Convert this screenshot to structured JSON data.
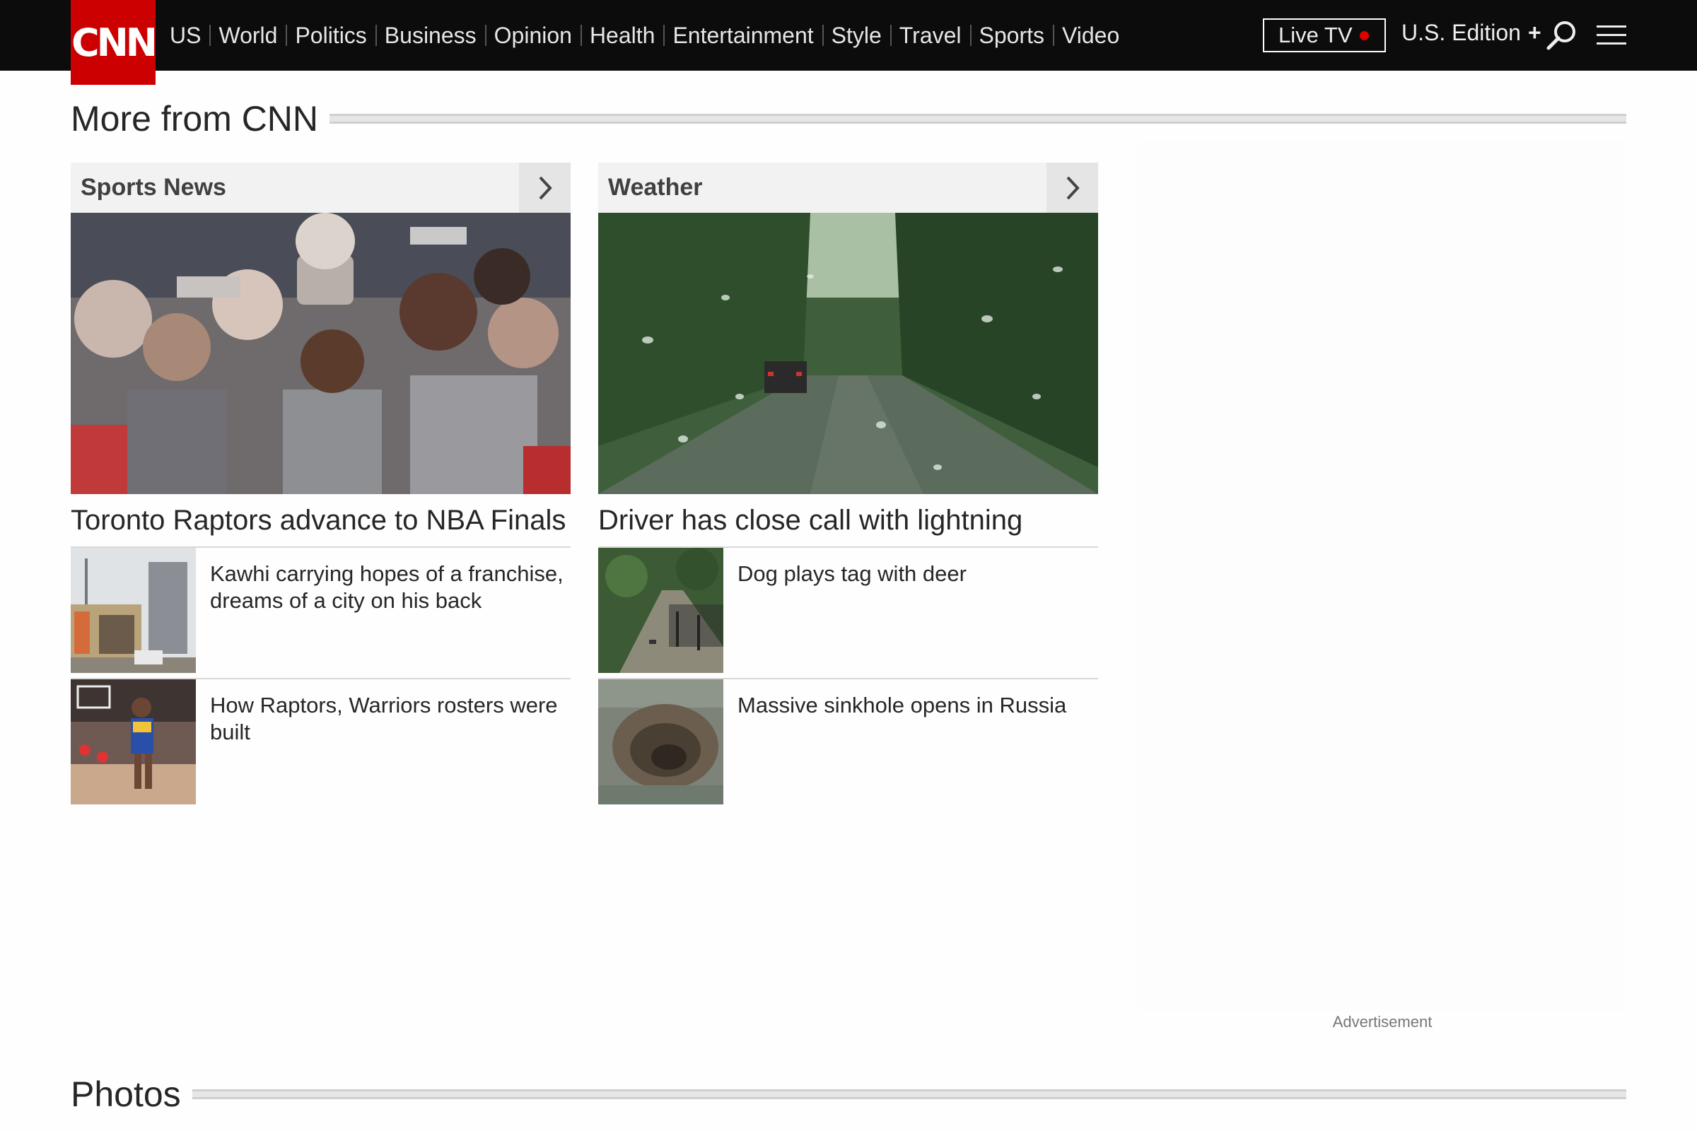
{
  "header": {
    "logo_text": "CNN",
    "brand_color": "#cc0000",
    "nav": [
      "US",
      "World",
      "Politics",
      "Business",
      "Opinion",
      "Health",
      "Entertainment",
      "Style",
      "Travel",
      "Sports",
      "Video"
    ],
    "live_tv_label": "Live TV",
    "edition_label": "U.S. Edition",
    "edition_plus": "+",
    "icons": [
      "search-icon",
      "menu-icon"
    ]
  },
  "more_from": {
    "title": "More from CNN",
    "columns": [
      {
        "label": "Sports News",
        "hero_image": "raptors-celebration-photo",
        "hero_title": "Toronto Raptors advance to NBA Finals",
        "items": [
          {
            "image": "toronto-street-photo",
            "title": "Kawhi carrying hopes of a franchise, dreams of a city on his back"
          },
          {
            "image": "warriors-player-photo",
            "title": "How Raptors, Warriors rosters were built"
          }
        ]
      },
      {
        "label": "Weather",
        "hero_image": "rainy-road-photo",
        "hero_title": "Driver has close call with lightning",
        "items": [
          {
            "image": "dog-deer-photo",
            "title": "Dog plays tag with deer"
          },
          {
            "image": "sinkhole-photo",
            "title": "Massive sinkhole opens in Russia"
          }
        ]
      }
    ]
  },
  "advertisement_label": "Advertisement",
  "photos": {
    "title": "Photos"
  }
}
